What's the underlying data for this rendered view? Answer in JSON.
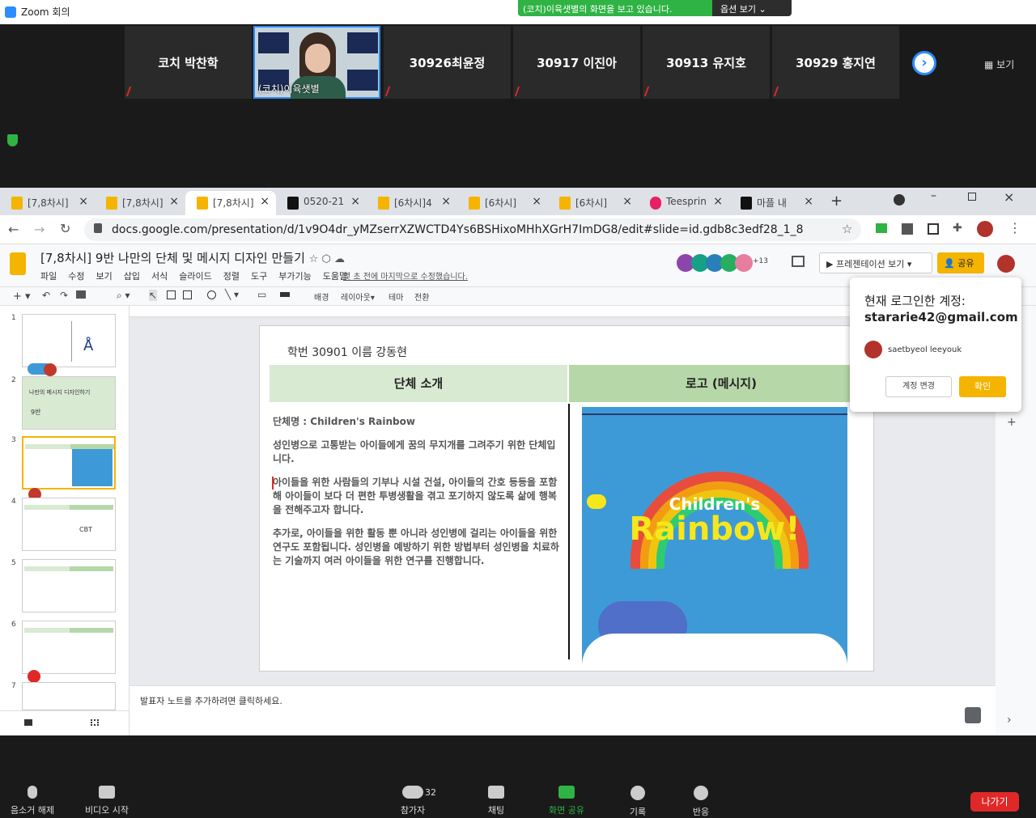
{
  "zoom": {
    "window_title": "Zoom 회의",
    "share_banner": "(코치)이육샛별의 화면을 보고 있습니다.",
    "options_label": "옵션 보기",
    "view_label": "보기",
    "participants": [
      {
        "name": "코치 박찬학"
      },
      {
        "name": "(코치)이육샛별"
      },
      {
        "name": "30926최윤정"
      },
      {
        "name": "30917 이진아"
      },
      {
        "name": "30913 유지호"
      },
      {
        "name": "30929 홍지연"
      }
    ],
    "bottom": {
      "unmute": "음소거 해제",
      "video": "비디오 시작",
      "participants": "참가자",
      "participant_count": "32",
      "chat": "채팅",
      "share": "화면 공유",
      "record": "기록",
      "reactions": "반응",
      "leave": "나가기"
    }
  },
  "browser": {
    "tabs": [
      {
        "label": "[7,8차시]"
      },
      {
        "label": "[7,8차시]"
      },
      {
        "label": "[7,8차시]"
      },
      {
        "label": "0520-21"
      },
      {
        "label": "[6차시]4"
      },
      {
        "label": "[6차시]"
      },
      {
        "label": "[6차시]"
      },
      {
        "label": "Teesprin"
      },
      {
        "label": "마플 내"
      }
    ],
    "url": "docs.google.com/presentation/d/1v9O4dr_yMZserrXZWCTD4Ys6BSHixoMHhXGrH7ImDG8/edit#slide=id.gdb8c3edf28_1_8"
  },
  "slides": {
    "title": "[7,8차시] 9반 나만의 단체 및 메시지 디자인 만들기",
    "menus": [
      "파일",
      "수정",
      "보기",
      "삽입",
      "서식",
      "슬라이드",
      "정렬",
      "도구",
      "부가기능",
      "도움말"
    ],
    "last_edit": "몇 초 전에 마지막으로 수정했습니다.",
    "present_label": "프레젠테이션 보기",
    "share_label": "공유",
    "collab_count": "+13",
    "toolbar": {
      "background": "배경",
      "layout": "레이아웃",
      "theme": "테마",
      "transition": "전환"
    },
    "speaker_notes": "발표자 노트를 추가하려면 클릭하세요.",
    "slide_numbers": [
      "1",
      "2",
      "3",
      "4",
      "5",
      "6",
      "7"
    ],
    "thumb2_text": "나만의 메시지 디자인하기",
    "thumb2_class": "9반",
    "slide": {
      "student": "학번 30901  이름 강동현",
      "col1_header": "단체 소개",
      "col2_header": "로고 (메시지)",
      "org_name": "단체명 : Children's Rainbow",
      "para1": "성인병으로 고통받는 아이들에게 꿈의 무지개를 그려주기 위한 단체입니다.",
      "para2": "아이들을 위한 사람들의 기부나 시설 건설, 아이들의 간호 등등을 포함해 아이들이 보다 더 편한 투병생활을 겪고 포기하지 않도록 삶에 행복을 전해주고자 합니다.",
      "para3": "추가로, 아이들을 위한 활동 뿐 아니라 성인병에 걸리는 아이들을 위한 연구도 포함됩니다. 성인병을 예방하기 위한 방법부터 성인병을 치료하는 기술까지 여러 아이들을 위한 연구를 진행합니다.",
      "logo_line1": "Children's",
      "logo_line2": "Rainbow!"
    }
  },
  "account_popup": {
    "heading": "현재 로그인한 계정:",
    "email": "stararie42@gmail.com",
    "user": "saetbyeol leeyouk",
    "switch": "계정 변경",
    "confirm": "확인"
  }
}
